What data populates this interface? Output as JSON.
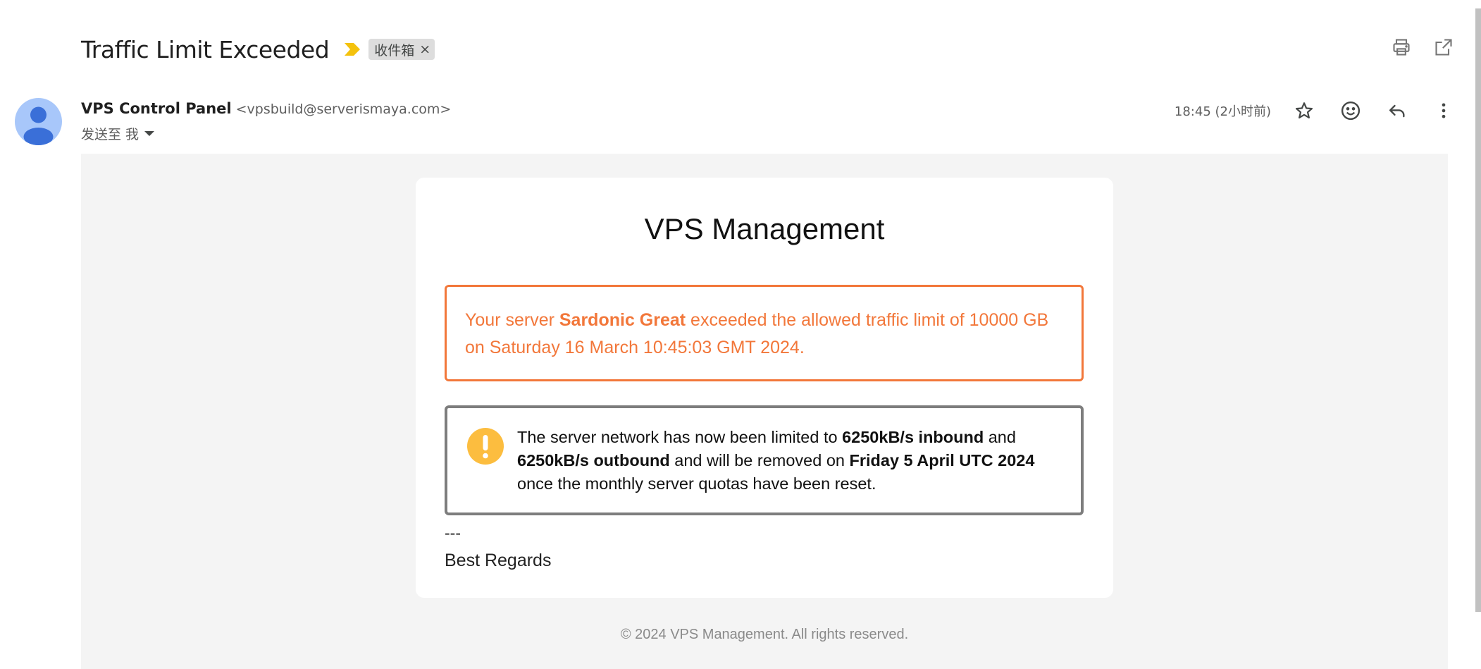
{
  "header": {
    "subject": "Traffic Limit Exceeded",
    "label": "收件箱",
    "label_remove": "×"
  },
  "sender": {
    "name": "VPS Control Panel",
    "email": "<vpsbuild@serverismaya.com>",
    "to": "发送至 我"
  },
  "meta": {
    "timestamp": "18:45 (2小时前)"
  },
  "icons": {
    "print": "print-icon",
    "open_new_window": "open-in-new-window-icon",
    "star": "star-icon",
    "emoji": "emoji-react-icon",
    "reply": "reply-icon",
    "more": "more-vert-icon",
    "importance": "importance-marker-icon",
    "avatar": "default-avatar-icon",
    "warning": "exclamation-icon"
  },
  "colors": {
    "alert_orange": "#f2773a",
    "alert_gray_border": "#7d7d7d",
    "warning_yellow": "#fcbd3f",
    "importance_yellow": "#f4c20d",
    "avatar_bg": "#a8c7fa",
    "avatar_fg": "#3a6fd8"
  },
  "body": {
    "title": "VPS Management",
    "alert": {
      "prefix": "Your server ",
      "server_name": "Sardonic Great",
      "suffix": " exceeded the allowed traffic limit of 10000 GB on Saturday 16 March 10:45:03 GMT 2024."
    },
    "notice": {
      "part1": "The server network has now been limited to ",
      "inbound": "6250kB/s inbound",
      "part2": " and ",
      "outbound": "6250kB/s outbound",
      "part3": " and will be removed on ",
      "date": "Friday 5 April UTC 2024",
      "part4": " once the monthly server quotas have been reset."
    },
    "signature_separator": "---",
    "signature": "Best Regards",
    "footer": "© 2024 VPS Management. All rights reserved."
  }
}
